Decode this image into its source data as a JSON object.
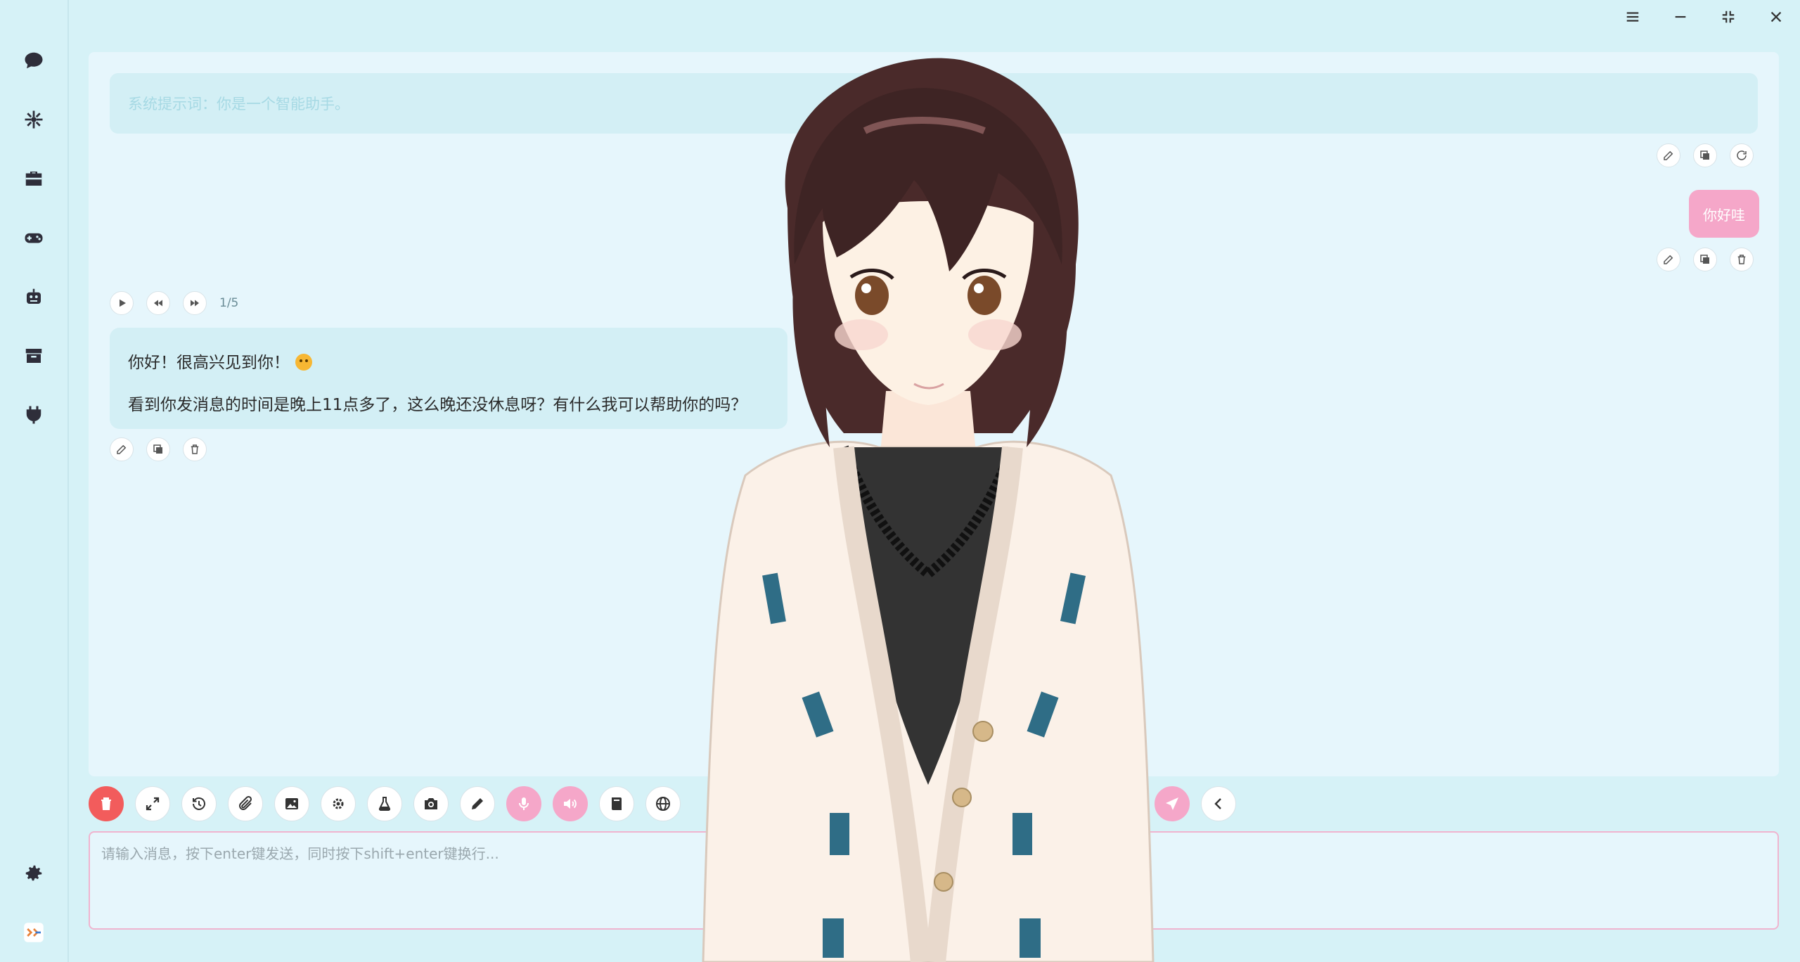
{
  "window": {
    "controls": [
      "menu-icon",
      "minimize-icon",
      "restore-icon",
      "close-icon"
    ]
  },
  "sidebar": {
    "items": [
      {
        "name": "chat",
        "icon": "chat-bubble-icon"
      },
      {
        "name": "network",
        "icon": "network-icon"
      },
      {
        "name": "toolbox",
        "icon": "toolbox-icon"
      },
      {
        "name": "game",
        "icon": "gamepad-icon"
      },
      {
        "name": "robot",
        "icon": "robot-icon"
      },
      {
        "name": "archive",
        "icon": "archive-icon"
      },
      {
        "name": "plugin",
        "icon": "plug-icon"
      }
    ],
    "bottom": [
      {
        "name": "settings",
        "icon": "gear-icon"
      },
      {
        "name": "app-logo",
        "icon": "logo-icon"
      }
    ]
  },
  "chat": {
    "system_prompt": "系统提示词：你是一个智能助手。",
    "user_message": "你好哇",
    "playback_count": "1/5",
    "ai_message_line1": "你好！很高兴见到你！",
    "ai_message_emoji": "smiling-face-emoji",
    "ai_message_line2": "看到你发消息的时间是晚上11点多了，这么晚还没休息呀？有什么我可以帮助你的吗？"
  },
  "toolbar": {
    "tools": [
      "trash-icon",
      "expand-icon",
      "history-icon",
      "paperclip-icon",
      "image-icon",
      "settings-cog-icon",
      "flask-icon",
      "camera-icon",
      "pencil-icon",
      "microphone-icon",
      "speaker-icon",
      "book-icon",
      "globe-icon"
    ],
    "send": "send-icon",
    "collapse": "chevron-left-icon"
  },
  "input": {
    "placeholder": "请输入消息，按下enter键发送，同时按下shift+enter键换行..."
  },
  "colors": {
    "background": "#d6f2f7",
    "panel": "#e6f6fc",
    "bubble": "#d3eff5",
    "user_bubble": "#f5a7c9",
    "danger": "#f25c5c",
    "accent_pink": "#f5a7c9",
    "input_border": "#f0b4cf"
  }
}
